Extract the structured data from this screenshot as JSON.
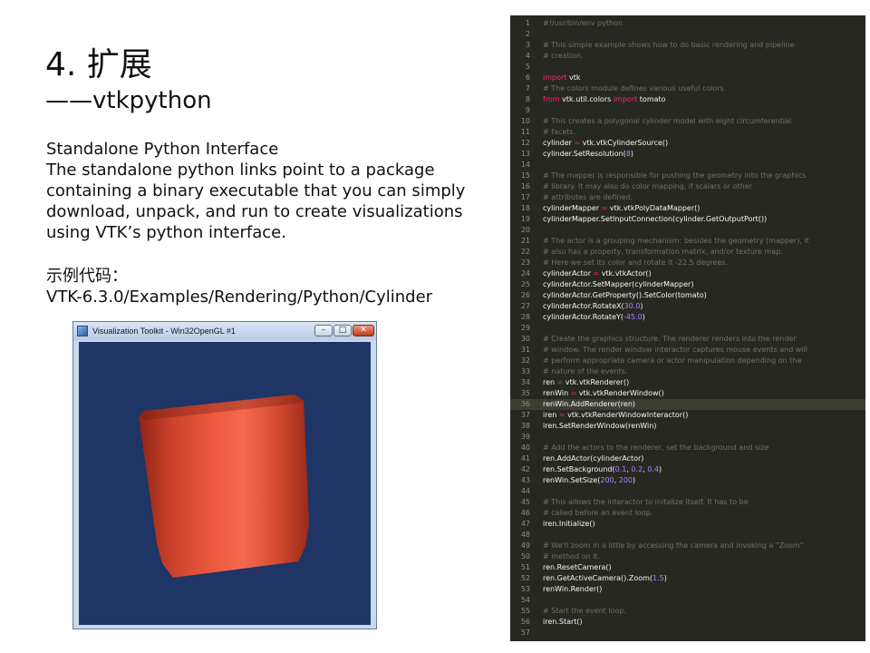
{
  "slide": {
    "title": "4. 扩展",
    "subtitle": "——vtkpython",
    "description": [
      "Standalone Python Interface",
      "The standalone python links point to a package",
      "containing a binary executable that you can simply",
      "download, unpack, and run to create visualizations",
      "using VTK’s python interface."
    ],
    "example_label": "示例代码：",
    "example_path": "VTK-6.3.0/Examples/Rendering/Python/Cylinder"
  },
  "vtk_window": {
    "title": "Visualization Toolkit - Win32OpenGL #1",
    "minimize": "–",
    "maximize": "□",
    "close": "✕",
    "background_color": "#1e3566",
    "cylinder_color": "#e8543c"
  },
  "editor": {
    "active_line": 36,
    "lines": [
      {
        "n": "1",
        "t": [
          [
            "c",
            "#!/usr/bin/env python"
          ]
        ]
      },
      {
        "n": "2",
        "t": []
      },
      {
        "n": "3",
        "t": [
          [
            "c",
            "# This simple example shows how to do basic rendering and pipeline"
          ]
        ]
      },
      {
        "n": "4",
        "t": [
          [
            "c",
            "# creation."
          ]
        ]
      },
      {
        "n": "5",
        "t": []
      },
      {
        "n": "6",
        "t": [
          [
            "k",
            "import"
          ],
          [
            "p",
            " vtk"
          ]
        ]
      },
      {
        "n": "7",
        "t": [
          [
            "c",
            "# The colors module defines various useful colors."
          ]
        ]
      },
      {
        "n": "8",
        "t": [
          [
            "k",
            "from"
          ],
          [
            "p",
            " vtk.util.colors "
          ],
          [
            "k",
            "import"
          ],
          [
            "p",
            " tomato"
          ]
        ]
      },
      {
        "n": "9",
        "t": []
      },
      {
        "n": "10",
        "t": [
          [
            "c",
            "# This creates a polygonal cylinder model with eight circumferential"
          ]
        ]
      },
      {
        "n": "11",
        "t": [
          [
            "c",
            "# facets."
          ]
        ]
      },
      {
        "n": "12",
        "t": [
          [
            "p",
            "cylinder "
          ],
          [
            "o",
            "="
          ],
          [
            "p",
            " vtk.vtkCylinderSource()"
          ]
        ]
      },
      {
        "n": "13",
        "t": [
          [
            "p",
            "cylinder.SetResolution("
          ],
          [
            "n",
            "8"
          ],
          [
            "p",
            ")"
          ]
        ]
      },
      {
        "n": "14",
        "t": []
      },
      {
        "n": "15",
        "t": [
          [
            "c",
            "# The mapper is responsible for pushing the geometry into the graphics"
          ]
        ]
      },
      {
        "n": "16",
        "t": [
          [
            "c",
            "# library. It may also do color mapping, if scalars or other"
          ]
        ]
      },
      {
        "n": "17",
        "t": [
          [
            "c",
            "# attributes are defined."
          ]
        ]
      },
      {
        "n": "18",
        "t": [
          [
            "p",
            "cylinderMapper "
          ],
          [
            "o",
            "="
          ],
          [
            "p",
            " vtk.vtkPolyDataMapper()"
          ]
        ]
      },
      {
        "n": "19",
        "t": [
          [
            "p",
            "cylinderMapper.SetInputConnection(cylinder.GetOutputPort())"
          ]
        ]
      },
      {
        "n": "20",
        "t": []
      },
      {
        "n": "21",
        "t": [
          [
            "c",
            "# The actor is a grouping mechanism: besides the geometry (mapper), it"
          ]
        ]
      },
      {
        "n": "22",
        "t": [
          [
            "c",
            "# also has a property, transformation matrix, and/or texture map."
          ]
        ]
      },
      {
        "n": "23",
        "t": [
          [
            "c",
            "# Here we set its color and rotate it -22.5 degrees."
          ]
        ]
      },
      {
        "n": "24",
        "t": [
          [
            "p",
            "cylinderActor "
          ],
          [
            "o",
            "="
          ],
          [
            "p",
            " vtk.vtkActor()"
          ]
        ]
      },
      {
        "n": "25",
        "t": [
          [
            "p",
            "cylinderActor.SetMapper(cylinderMapper)"
          ]
        ]
      },
      {
        "n": "26",
        "t": [
          [
            "p",
            "cylinderActor.GetProperty().SetColor(tomato)"
          ]
        ]
      },
      {
        "n": "27",
        "t": [
          [
            "p",
            "cylinderActor.RotateX("
          ],
          [
            "n",
            "30.0"
          ],
          [
            "p",
            ")"
          ]
        ]
      },
      {
        "n": "28",
        "t": [
          [
            "p",
            "cylinderActor.RotateY("
          ],
          [
            "n",
            "-45.0"
          ],
          [
            "p",
            ")"
          ]
        ]
      },
      {
        "n": "29",
        "t": []
      },
      {
        "n": "30",
        "t": [
          [
            "c",
            "# Create the graphics structure. The renderer renders into the render"
          ]
        ]
      },
      {
        "n": "31",
        "t": [
          [
            "c",
            "# window. The render window interactor captures mouse events and will"
          ]
        ]
      },
      {
        "n": "32",
        "t": [
          [
            "c",
            "# perform appropriate camera or actor manipulation depending on the"
          ]
        ]
      },
      {
        "n": "33",
        "t": [
          [
            "c",
            "# nature of the events."
          ]
        ]
      },
      {
        "n": "34",
        "t": [
          [
            "p",
            "ren "
          ],
          [
            "o",
            "="
          ],
          [
            "p",
            " vtk.vtkRenderer()"
          ]
        ]
      },
      {
        "n": "35",
        "t": [
          [
            "p",
            "renWin "
          ],
          [
            "o",
            "="
          ],
          [
            "p",
            " vtk.vtkRenderWindow()"
          ]
        ]
      },
      {
        "n": "36",
        "t": [
          [
            "p",
            "renWin.AddRenderer(ren)"
          ]
        ]
      },
      {
        "n": "37",
        "t": [
          [
            "p",
            "iren "
          ],
          [
            "o",
            "="
          ],
          [
            "p",
            " vtk.vtkRenderWindowInteractor()"
          ]
        ]
      },
      {
        "n": "38",
        "t": [
          [
            "p",
            "iren.SetRenderWindow(renWin)"
          ]
        ]
      },
      {
        "n": "39",
        "t": []
      },
      {
        "n": "40",
        "t": [
          [
            "c",
            "# Add the actors to the renderer, set the background and size"
          ]
        ]
      },
      {
        "n": "41",
        "t": [
          [
            "p",
            "ren.AddActor(cylinderActor)"
          ]
        ]
      },
      {
        "n": "42",
        "t": [
          [
            "p",
            "ren.SetBackground("
          ],
          [
            "n",
            "0.1"
          ],
          [
            "p",
            ", "
          ],
          [
            "n",
            "0.2"
          ],
          [
            "p",
            ", "
          ],
          [
            "n",
            "0.4"
          ],
          [
            "p",
            ")"
          ]
        ]
      },
      {
        "n": "43",
        "t": [
          [
            "p",
            "renWin.SetSize("
          ],
          [
            "n",
            "200"
          ],
          [
            "p",
            ", "
          ],
          [
            "n",
            "200"
          ],
          [
            "p",
            ")"
          ]
        ]
      },
      {
        "n": "44",
        "t": []
      },
      {
        "n": "45",
        "t": [
          [
            "c",
            "# This allows the interactor to initalize itself. It has to be"
          ]
        ]
      },
      {
        "n": "46",
        "t": [
          [
            "c",
            "# called before an event loop."
          ]
        ]
      },
      {
        "n": "47",
        "t": [
          [
            "p",
            "iren.Initialize()"
          ]
        ]
      },
      {
        "n": "48",
        "t": []
      },
      {
        "n": "49",
        "t": [
          [
            "c",
            "# We'll zoom in a little by accessing the camera and invoking a \"Zoom\""
          ]
        ]
      },
      {
        "n": "50",
        "t": [
          [
            "c",
            "# method on it."
          ]
        ]
      },
      {
        "n": "51",
        "t": [
          [
            "p",
            "ren.ResetCamera()"
          ]
        ]
      },
      {
        "n": "52",
        "t": [
          [
            "p",
            "ren.GetActiveCamera().Zoom("
          ],
          [
            "n",
            "1.5"
          ],
          [
            "p",
            ")"
          ]
        ]
      },
      {
        "n": "53",
        "t": [
          [
            "p",
            "renWin.Render()"
          ]
        ]
      },
      {
        "n": "54",
        "t": []
      },
      {
        "n": "55",
        "t": [
          [
            "c",
            "# Start the event loop."
          ]
        ]
      },
      {
        "n": "56",
        "t": [
          [
            "p",
            "iren.Start()"
          ]
        ]
      },
      {
        "n": "57",
        "t": []
      }
    ]
  }
}
